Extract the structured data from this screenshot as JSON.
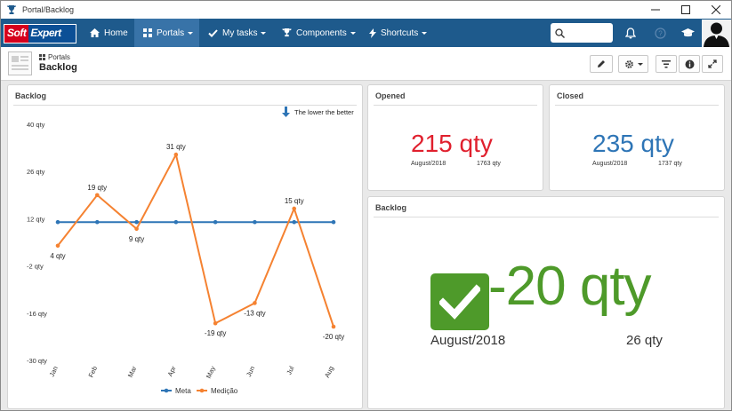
{
  "window": {
    "title": "Portal/Backlog"
  },
  "nav": {
    "logo_soft": "Soft",
    "logo_expert": "Expert",
    "items": [
      {
        "label": "Home"
      },
      {
        "label": "Portals"
      },
      {
        "label": "My tasks"
      },
      {
        "label": "Components"
      },
      {
        "label": "Shortcuts"
      }
    ],
    "search_placeholder": ""
  },
  "header": {
    "breadcrumb": "Portals",
    "title": "Backlog"
  },
  "backlog_chart": {
    "title": "Backlog",
    "hint": "The lower the better",
    "legend": [
      {
        "name": "Meta",
        "color": "#2e75b6"
      },
      {
        "name": "Medição",
        "color": "#f58231"
      }
    ]
  },
  "chart_data": {
    "type": "line",
    "title": "Backlog",
    "categories": [
      "Jan",
      "Feb",
      "Mar",
      "Apr",
      "May",
      "Jun",
      "Jul",
      "Aug"
    ],
    "yticks": [
      "40 qty",
      "26 qty",
      "12 qty",
      "-2 qty",
      "-16 qty",
      "-30 qty"
    ],
    "ylim": [
      -30,
      40
    ],
    "series": [
      {
        "name": "Meta",
        "color": "#2e75b6",
        "values": [
          11,
          11,
          11,
          11,
          11,
          11,
          11,
          11
        ],
        "labels": [
          "",
          "",
          "",
          "",
          "",
          "",
          "",
          ""
        ]
      },
      {
        "name": "Medição",
        "color": "#f58231",
        "values": [
          4,
          19,
          9,
          31,
          -19,
          -13,
          15,
          -20
        ],
        "labels": [
          "4 qty",
          "19 qty",
          "9 qty",
          "31 qty",
          "-19 qty",
          "-13 qty",
          "15 qty",
          "-20 qty"
        ]
      }
    ],
    "legend": "bottom",
    "grid": false
  },
  "opened": {
    "title": "Opened",
    "value": "215 qty",
    "period": "August/2018",
    "reference": "1763 qty",
    "color": "#e0202e"
  },
  "closed": {
    "title": "Closed",
    "value": "235 qty",
    "period": "August/2018",
    "reference": "1737 qty",
    "color": "#2e75b6"
  },
  "backlog_kpi": {
    "title": "Backlog",
    "value": "-20 qty",
    "period": "August/2018",
    "reference": "26 qty",
    "color": "#4e9a2a"
  }
}
